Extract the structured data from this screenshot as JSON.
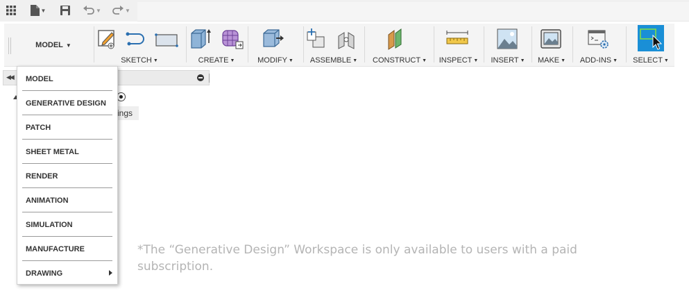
{
  "toolbar": {
    "workspace_label": "MODEL",
    "groups": [
      {
        "label": "SKETCH"
      },
      {
        "label": "CREATE"
      },
      {
        "label": "MODIFY"
      },
      {
        "label": "ASSEMBLE"
      },
      {
        "label": "CONSTRUCT"
      },
      {
        "label": "INSPECT"
      },
      {
        "label": "INSERT"
      },
      {
        "label": "MAKE"
      },
      {
        "label": "ADD-INS"
      },
      {
        "label": "SELECT"
      }
    ],
    "select_color": "#1a8fd6"
  },
  "browser": {
    "partial_label": "ings"
  },
  "workspace_menu": {
    "items": [
      {
        "label": "MODEL"
      },
      {
        "label": "GENERATIVE DESIGN"
      },
      {
        "label": "PATCH"
      },
      {
        "label": "SHEET METAL"
      },
      {
        "label": "RENDER"
      },
      {
        "label": "ANIMATION"
      },
      {
        "label": "SIMULATION"
      },
      {
        "label": "MANUFACTURE"
      },
      {
        "label": "DRAWING"
      }
    ]
  },
  "footnote": "*The “Generative Design” Workspace is only available to users with a paid subscription."
}
